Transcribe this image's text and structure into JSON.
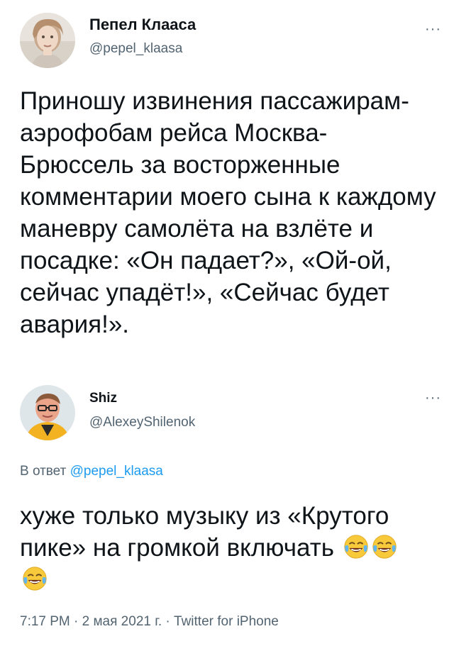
{
  "tweet": {
    "author_name": "Пепел Клааса",
    "author_handle": "@pepel_klaasa",
    "more_label": "···",
    "text": "Приношу извинения пассажирам-аэрофобам рейса Москва-Брюссель за восторженные комментарии моего сына к каждому маневру самолёта на взлёте и посадке: «Он падает?», «Ой-ой, сейчас упадёт!», «Сейчас будет авария!»."
  },
  "reply": {
    "author_name": "Shiz",
    "author_handle": "@AlexeyShilenok",
    "more_label": "···",
    "reply_prefix": "В ответ",
    "reply_handle": "@pepel_klaasa",
    "text": "хуже только музыку из «Крутого пике» на громкой включать",
    "emoji_icons": [
      "face-with-tears-of-joy-icon",
      "face-with-tears-of-joy-icon",
      "face-with-tears-of-joy-icon"
    ],
    "meta": "7:17 PM · 2 мая 2021 г. · Twitter for iPhone"
  },
  "colors": {
    "text": "#0f1419",
    "secondary": "#536471",
    "link": "#1d9bf0"
  }
}
